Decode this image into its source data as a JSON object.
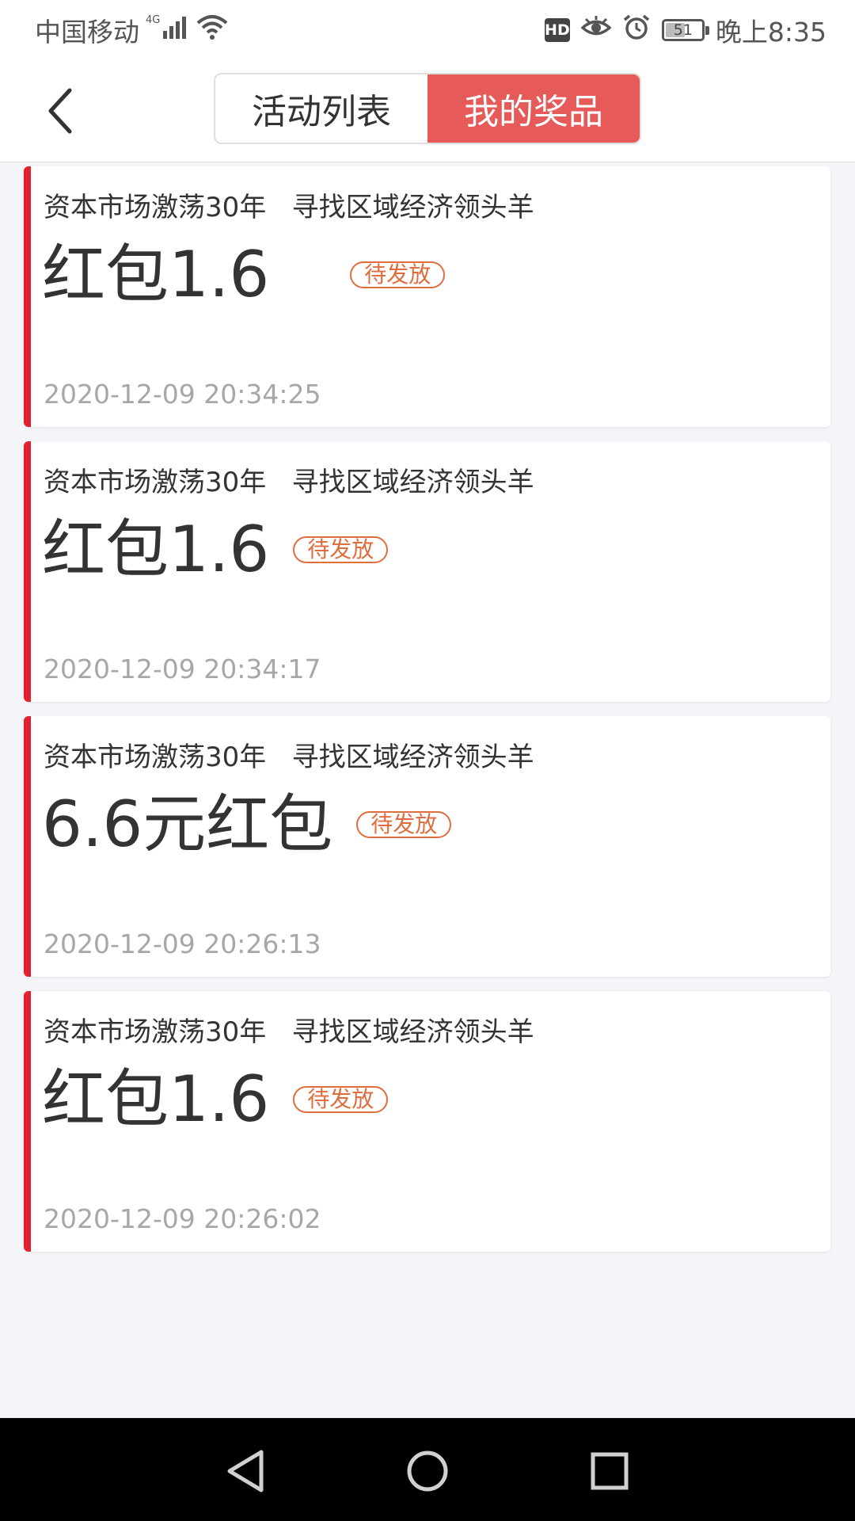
{
  "status_bar": {
    "carrier": "中国移动",
    "network": "4G",
    "battery_level": "51",
    "time": "晚上8:35",
    "hd_label": "HD"
  },
  "header": {
    "tabs": [
      {
        "label": "活动列表",
        "active": false
      },
      {
        "label": "我的奖品",
        "active": true
      }
    ]
  },
  "prizes": [
    {
      "title": "资本市场激荡30年   寻找区域经济领头羊",
      "prize": "红包1.6",
      "status": "待发放",
      "time": "2020-12-09 20:34:25"
    },
    {
      "title": "资本市场激荡30年   寻找区域经济领头羊",
      "prize": "红包1.6",
      "status": "待发放",
      "time": "2020-12-09 20:34:17"
    },
    {
      "title": "资本市场激荡30年   寻找区域经济领头羊",
      "prize": "6.6元红包",
      "status": "待发放",
      "time": "2020-12-09 20:26:13"
    },
    {
      "title": "资本市场激荡30年   寻找区域经济领头羊",
      "prize": "红包1.6",
      "status": "待发放",
      "time": "2020-12-09 20:26:02"
    }
  ],
  "colors": {
    "accent": "#e3202e",
    "tab_active": "#e65a5a",
    "badge": "#e06d3e"
  },
  "icons": {
    "back": "chevron-left-icon",
    "nav_back": "triangle-back-icon",
    "nav_home": "circle-home-icon",
    "nav_recents": "square-recents-icon"
  }
}
